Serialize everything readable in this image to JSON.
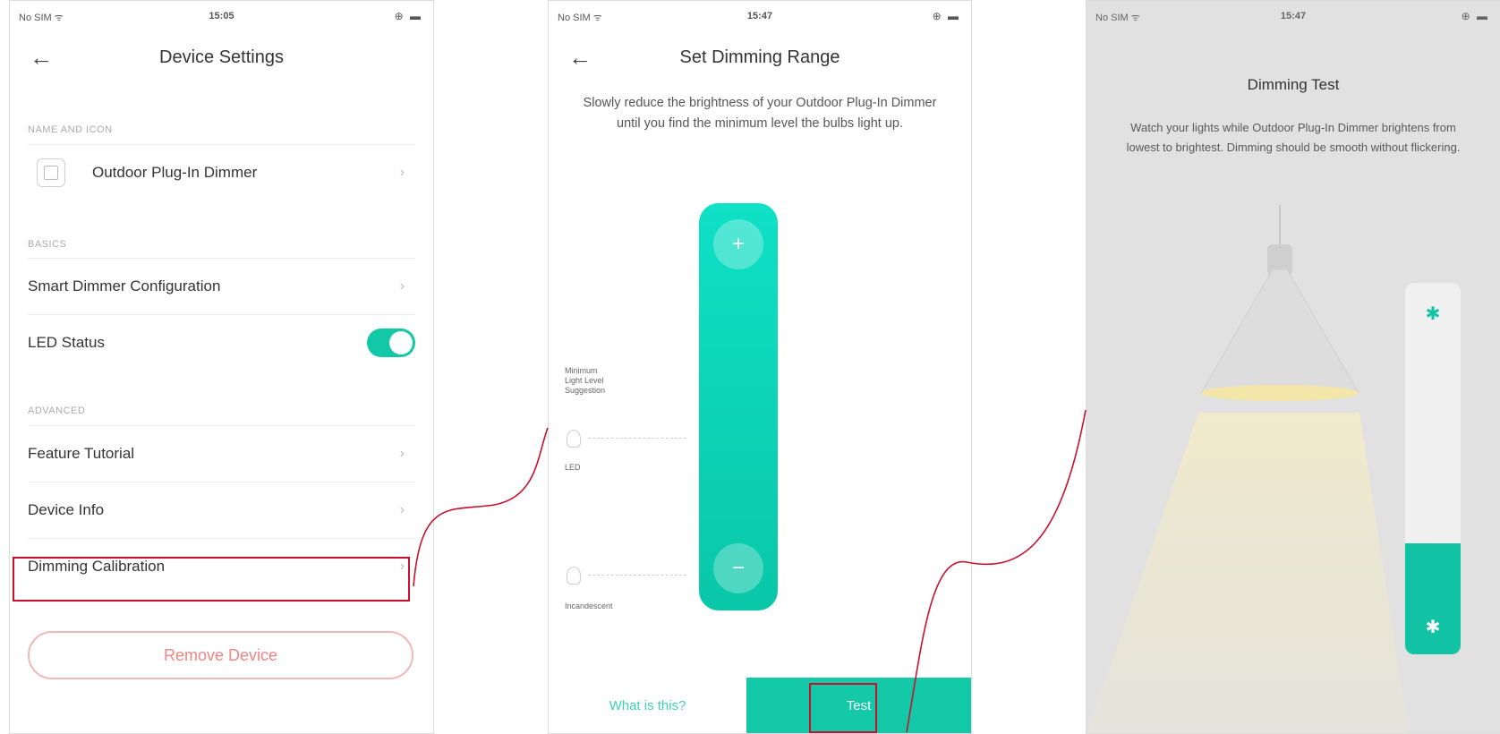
{
  "screen1": {
    "status": {
      "carrier": "No SIM ᯤ",
      "time": "15:05",
      "battery": "⊕ ▬"
    },
    "title": "Device Settings",
    "sections": {
      "name_icon": "NAME AND ICON",
      "basics": "BASICS",
      "advanced": "ADVANCED"
    },
    "device_name": "Outdoor Plug-In Dimmer",
    "rows": {
      "smart_dimmer": "Smart Dimmer Configuration",
      "led_status": "LED Status",
      "feature_tutorial": "Feature Tutorial",
      "device_info": "Device Info",
      "dimming_calibration": "Dimming Calibration"
    },
    "led_status_on": true,
    "remove_label": "Remove Device"
  },
  "screen2": {
    "status": {
      "carrier": "No SIM ᯤ",
      "time": "15:47",
      "battery": "⊕ ▬"
    },
    "title": "Set Dimming Range",
    "instruction": "Slowly reduce the brightness of your Outdoor Plug-In Dimmer until you find the minimum level the bulbs light up.",
    "plus": "+",
    "minus": "−",
    "labels": {
      "min_suggestion_1": "Minimum",
      "min_suggestion_2": "Light Level",
      "min_suggestion_3": "Suggestion",
      "led": "LED",
      "incandescent": "Incandescent"
    },
    "what_is_this": "What is this?",
    "test": "Test"
  },
  "screen3": {
    "status": {
      "carrier": "No SIM ᯤ",
      "time": "15:47",
      "battery": "⊕ ▬"
    },
    "title": "Dimming Test",
    "instruction": "Watch your lights while Outdoor Plug-In Dimmer brightens from lowest to brightest. Dimming should be smooth without flickering.",
    "level_fraction": 0.3,
    "sun_top": "✱",
    "sun_bottom": "✱"
  },
  "colors": {
    "accent": "#12c8a6",
    "highlight": "#c8102e",
    "remove_text": "#f08585"
  }
}
